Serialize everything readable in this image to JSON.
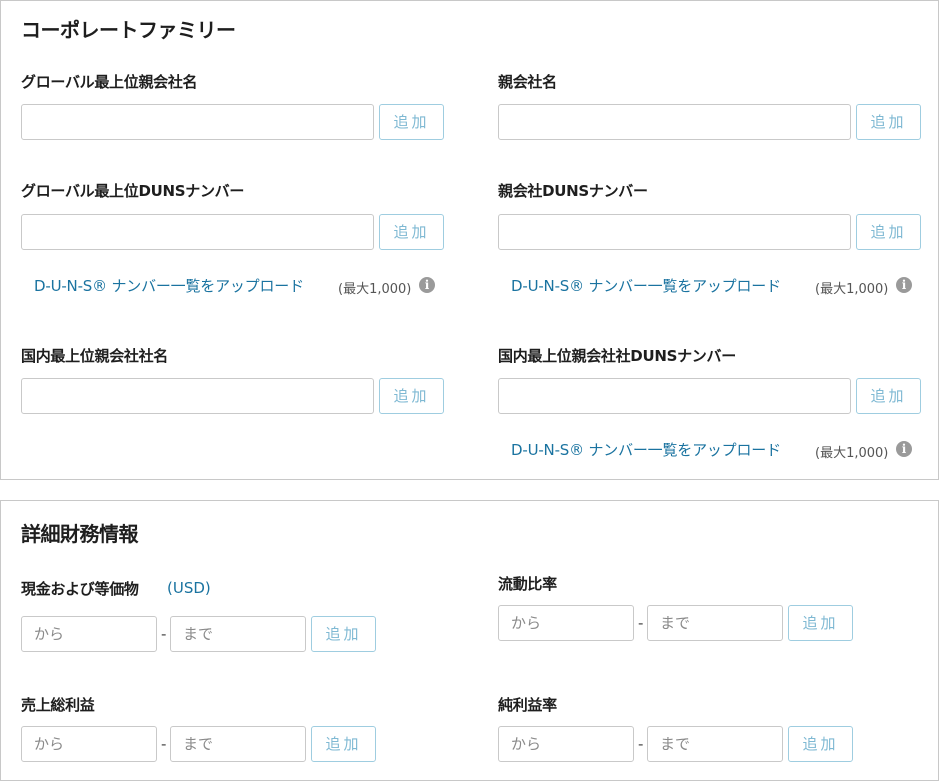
{
  "corporate_family": {
    "title": "コーポレートファミリー",
    "global_parent_name": {
      "label": "グローバル最上位親会社名",
      "value": "",
      "add": "追加"
    },
    "parent_name": {
      "label": "親会社名",
      "value": "",
      "add": "追加"
    },
    "global_parent_duns": {
      "label": "グローバル最上位DUNSナンバー",
      "value": "",
      "add": "追加",
      "upload_link": "D-U-N-S® ナンバー一覧をアップロード",
      "max": "(最大1,000)"
    },
    "parent_duns": {
      "label": "親会社DUNSナンバー",
      "value": "",
      "add": "追加",
      "upload_link": "D-U-N-S® ナンバー一覧をアップロード",
      "max": "(最大1,000)"
    },
    "domestic_parent_name": {
      "label": "国内最上位親会社社名",
      "value": "",
      "add": "追加"
    },
    "domestic_parent_duns": {
      "label": "国内最上位親会社社DUNSナンバー",
      "value": "",
      "add": "追加",
      "upload_link": "D-U-N-S® ナンバー一覧をアップロード",
      "max": "(最大1,000)"
    }
  },
  "financials": {
    "title": "詳細財務情報",
    "cash": {
      "label": "現金および等価物",
      "unit": "(USD)",
      "from_placeholder": "から",
      "to_placeholder": "まで",
      "separator": "-",
      "add": "追加"
    },
    "current_ratio": {
      "label": "流動比率",
      "from_placeholder": "から",
      "to_placeholder": "まで",
      "separator": "-",
      "add": "追加"
    },
    "gross_profit": {
      "label": "売上総利益",
      "from_placeholder": "から",
      "to_placeholder": "まで",
      "separator": "-",
      "add": "追加"
    },
    "net_margin": {
      "label": "純利益率",
      "from_placeholder": "から",
      "to_placeholder": "まで",
      "separator": "-",
      "add": "追加"
    }
  },
  "icons": {
    "info": "info-icon"
  }
}
